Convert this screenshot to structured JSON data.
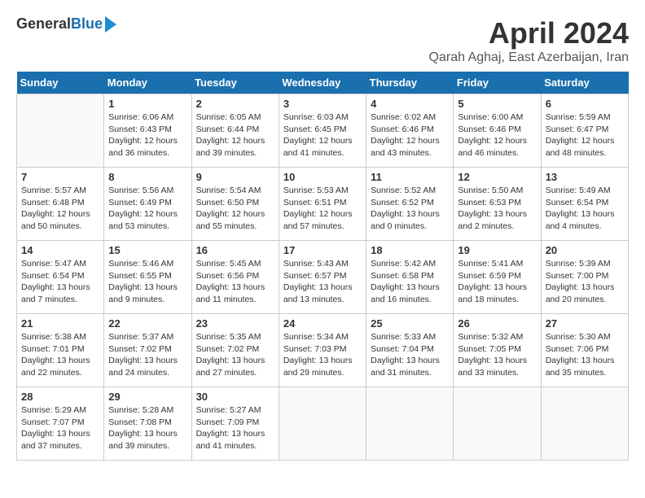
{
  "header": {
    "logo_line1": "General",
    "logo_line2": "Blue",
    "month_title": "April 2024",
    "location": "Qarah Aghaj, East Azerbaijan, Iran"
  },
  "weekdays": [
    "Sunday",
    "Monday",
    "Tuesday",
    "Wednesday",
    "Thursday",
    "Friday",
    "Saturday"
  ],
  "weeks": [
    [
      {
        "day": "",
        "info": ""
      },
      {
        "day": "1",
        "info": "Sunrise: 6:06 AM\nSunset: 6:43 PM\nDaylight: 12 hours\nand 36 minutes."
      },
      {
        "day": "2",
        "info": "Sunrise: 6:05 AM\nSunset: 6:44 PM\nDaylight: 12 hours\nand 39 minutes."
      },
      {
        "day": "3",
        "info": "Sunrise: 6:03 AM\nSunset: 6:45 PM\nDaylight: 12 hours\nand 41 minutes."
      },
      {
        "day": "4",
        "info": "Sunrise: 6:02 AM\nSunset: 6:46 PM\nDaylight: 12 hours\nand 43 minutes."
      },
      {
        "day": "5",
        "info": "Sunrise: 6:00 AM\nSunset: 6:46 PM\nDaylight: 12 hours\nand 46 minutes."
      },
      {
        "day": "6",
        "info": "Sunrise: 5:59 AM\nSunset: 6:47 PM\nDaylight: 12 hours\nand 48 minutes."
      }
    ],
    [
      {
        "day": "7",
        "info": "Sunrise: 5:57 AM\nSunset: 6:48 PM\nDaylight: 12 hours\nand 50 minutes."
      },
      {
        "day": "8",
        "info": "Sunrise: 5:56 AM\nSunset: 6:49 PM\nDaylight: 12 hours\nand 53 minutes."
      },
      {
        "day": "9",
        "info": "Sunrise: 5:54 AM\nSunset: 6:50 PM\nDaylight: 12 hours\nand 55 minutes."
      },
      {
        "day": "10",
        "info": "Sunrise: 5:53 AM\nSunset: 6:51 PM\nDaylight: 12 hours\nand 57 minutes."
      },
      {
        "day": "11",
        "info": "Sunrise: 5:52 AM\nSunset: 6:52 PM\nDaylight: 13 hours\nand 0 minutes."
      },
      {
        "day": "12",
        "info": "Sunrise: 5:50 AM\nSunset: 6:53 PM\nDaylight: 13 hours\nand 2 minutes."
      },
      {
        "day": "13",
        "info": "Sunrise: 5:49 AM\nSunset: 6:54 PM\nDaylight: 13 hours\nand 4 minutes."
      }
    ],
    [
      {
        "day": "14",
        "info": "Sunrise: 5:47 AM\nSunset: 6:54 PM\nDaylight: 13 hours\nand 7 minutes."
      },
      {
        "day": "15",
        "info": "Sunrise: 5:46 AM\nSunset: 6:55 PM\nDaylight: 13 hours\nand 9 minutes."
      },
      {
        "day": "16",
        "info": "Sunrise: 5:45 AM\nSunset: 6:56 PM\nDaylight: 13 hours\nand 11 minutes."
      },
      {
        "day": "17",
        "info": "Sunrise: 5:43 AM\nSunset: 6:57 PM\nDaylight: 13 hours\nand 13 minutes."
      },
      {
        "day": "18",
        "info": "Sunrise: 5:42 AM\nSunset: 6:58 PM\nDaylight: 13 hours\nand 16 minutes."
      },
      {
        "day": "19",
        "info": "Sunrise: 5:41 AM\nSunset: 6:59 PM\nDaylight: 13 hours\nand 18 minutes."
      },
      {
        "day": "20",
        "info": "Sunrise: 5:39 AM\nSunset: 7:00 PM\nDaylight: 13 hours\nand 20 minutes."
      }
    ],
    [
      {
        "day": "21",
        "info": "Sunrise: 5:38 AM\nSunset: 7:01 PM\nDaylight: 13 hours\nand 22 minutes."
      },
      {
        "day": "22",
        "info": "Sunrise: 5:37 AM\nSunset: 7:02 PM\nDaylight: 13 hours\nand 24 minutes."
      },
      {
        "day": "23",
        "info": "Sunrise: 5:35 AM\nSunset: 7:02 PM\nDaylight: 13 hours\nand 27 minutes."
      },
      {
        "day": "24",
        "info": "Sunrise: 5:34 AM\nSunset: 7:03 PM\nDaylight: 13 hours\nand 29 minutes."
      },
      {
        "day": "25",
        "info": "Sunrise: 5:33 AM\nSunset: 7:04 PM\nDaylight: 13 hours\nand 31 minutes."
      },
      {
        "day": "26",
        "info": "Sunrise: 5:32 AM\nSunset: 7:05 PM\nDaylight: 13 hours\nand 33 minutes."
      },
      {
        "day": "27",
        "info": "Sunrise: 5:30 AM\nSunset: 7:06 PM\nDaylight: 13 hours\nand 35 minutes."
      }
    ],
    [
      {
        "day": "28",
        "info": "Sunrise: 5:29 AM\nSunset: 7:07 PM\nDaylight: 13 hours\nand 37 minutes."
      },
      {
        "day": "29",
        "info": "Sunrise: 5:28 AM\nSunset: 7:08 PM\nDaylight: 13 hours\nand 39 minutes."
      },
      {
        "day": "30",
        "info": "Sunrise: 5:27 AM\nSunset: 7:09 PM\nDaylight: 13 hours\nand 41 minutes."
      },
      {
        "day": "",
        "info": ""
      },
      {
        "day": "",
        "info": ""
      },
      {
        "day": "",
        "info": ""
      },
      {
        "day": "",
        "info": ""
      }
    ]
  ]
}
